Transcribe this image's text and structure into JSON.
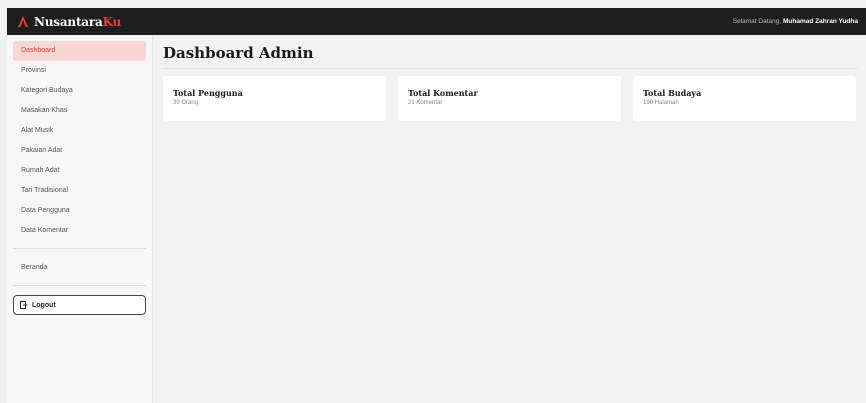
{
  "brand": {
    "name": "Nusantara",
    "accent": "Ku"
  },
  "header": {
    "welcome_prefix": "Selamat Datang, ",
    "user_name": "Muhamad Zahran Yudha"
  },
  "sidebar": {
    "items": [
      {
        "label": "Dashboard"
      },
      {
        "label": "Provinsi"
      },
      {
        "label": "Kategori Budaya"
      },
      {
        "label": "Masakan Khas"
      },
      {
        "label": "Alat Musik"
      },
      {
        "label": "Pakaian Adat"
      },
      {
        "label": "Rumah Adat"
      },
      {
        "label": "Tari Tradisional"
      },
      {
        "label": "Data Pengguna"
      },
      {
        "label": "Data Komentar"
      }
    ],
    "home_label": "Beranda",
    "logout_label": "Logout"
  },
  "main": {
    "title": "Dashboard Admin",
    "cards": [
      {
        "title": "Total Pengguna",
        "value": "39 Orang"
      },
      {
        "title": "Total Komentar",
        "value": "21 Komentar"
      },
      {
        "title": "Total Budaya",
        "value": "190 Halaman"
      }
    ]
  },
  "colors": {
    "accent": "#e0403a",
    "active_bg": "#f8d6d4",
    "topbar": "#1e1e1e"
  }
}
